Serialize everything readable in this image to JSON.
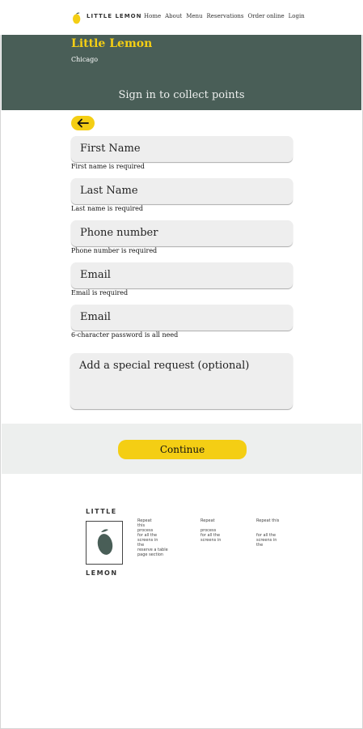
{
  "nav": {
    "logo_text": "LITTLE LEMON",
    "links": [
      "Home",
      "About",
      "Menu",
      "Reservations",
      "Order online",
      "Login"
    ]
  },
  "hero": {
    "title": "Little Lemon",
    "subtitle": "Chicago",
    "cta": "Sign in to collect points"
  },
  "form": {
    "fields": [
      {
        "label": "First Name",
        "error": "First name is required"
      },
      {
        "label": "Last Name",
        "error": "Last name is required"
      },
      {
        "label": "Phone number",
        "error": "Phone number is required"
      },
      {
        "label": "Email",
        "error": "Email is required"
      },
      {
        "label": "Email",
        "error": "6-character password is all need"
      }
    ],
    "special_request": "Add a special request (optional)",
    "continue_label": "Continue"
  },
  "footer": {
    "logo_top": "LITTLE",
    "logo_bottom": "LEMON",
    "columns": [
      [
        "Repeat",
        "this",
        "process",
        "for all the",
        "screens in",
        "the",
        "reserve a table",
        "page section"
      ],
      [
        "Repeat",
        "",
        "process",
        "for all the",
        "screens in"
      ],
      [
        "Repeat this",
        "",
        "",
        "for all the",
        "screens in",
        "the"
      ]
    ]
  },
  "colors": {
    "primary_green": "#495e57",
    "primary_yellow": "#f4ce14",
    "highlight_gray": "#edefee"
  }
}
